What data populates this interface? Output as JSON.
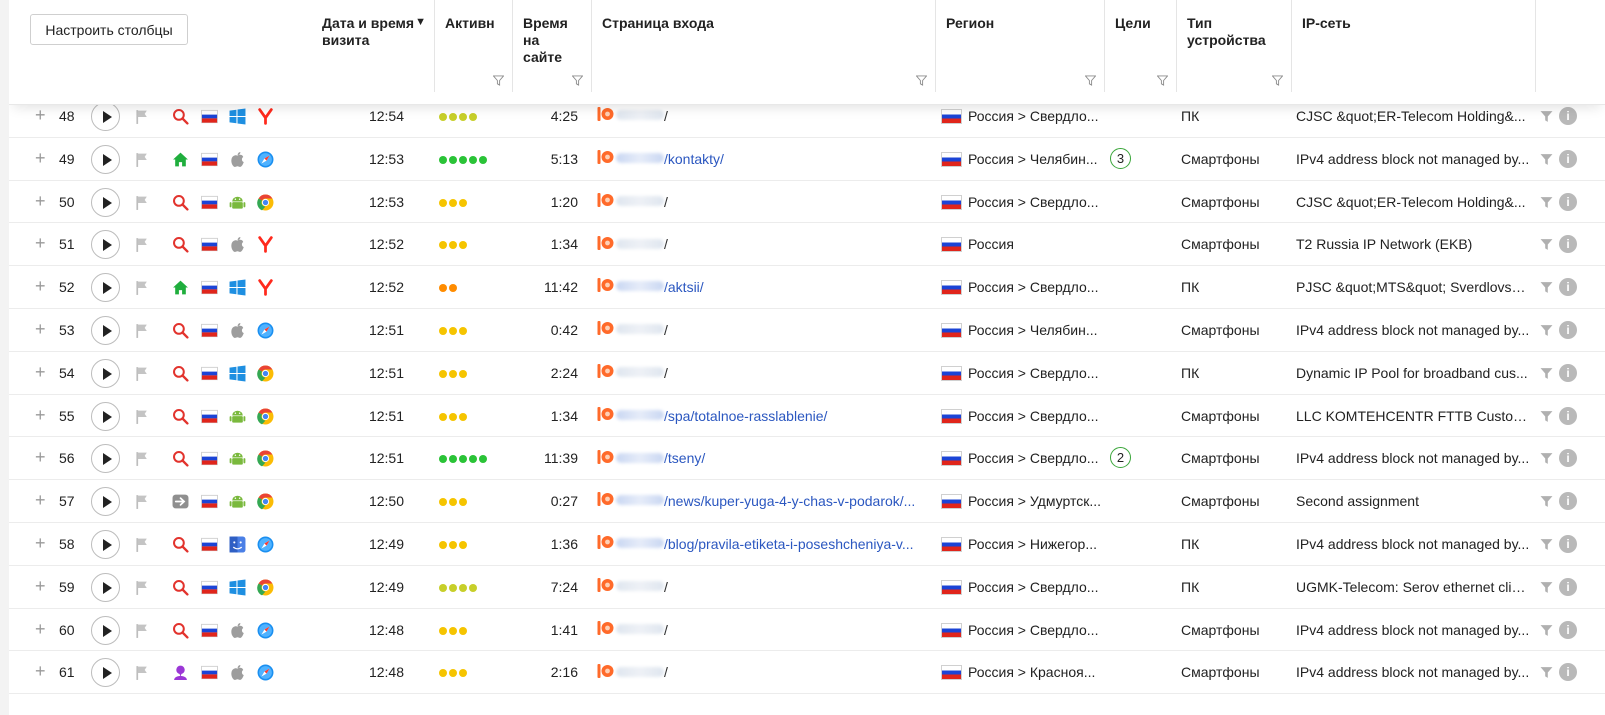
{
  "toolbar": {
    "configure_columns_label": "Настроить столбцы"
  },
  "columns": {
    "datetime": "Дата и время визита",
    "activity": "Активн",
    "duration": "Время на сайте",
    "entry_page": "Страница входа",
    "region": "Регион",
    "goals": "Цели",
    "device_type": "Тип устройства",
    "ip_network": "IP-сеть"
  },
  "colors": {
    "link": "#2b57c0",
    "goal_border": "#3aa63a",
    "dot_yellow": "#f5c400",
    "dot_lime": "#c7cf2a",
    "dot_green": "#2ac337",
    "dot_orange": "#ff8c00",
    "search_red": "#e2332d",
    "home_green": "#1fae3d"
  },
  "rows": [
    {
      "num": "48",
      "source": "search",
      "os": "windows",
      "browser": "yandex",
      "time": "12:54",
      "activity": 4,
      "activity_color": "lime",
      "duration": "4:25",
      "entry_path": "/",
      "region": "Россия > Свердло...",
      "goals": "",
      "device": "ПК",
      "ip_net": "CJSC &quot;ER-Telecom Holding&..."
    },
    {
      "num": "49",
      "source": "direct",
      "os": "apple",
      "browser": "safari",
      "time": "12:53",
      "activity": 5,
      "activity_color": "green",
      "duration": "5:13",
      "entry_path": "/kontakty/",
      "region": "Россия > Челябин...",
      "goals": "3",
      "device": "Смартфоны",
      "ip_net": "IPv4 address block not managed by..."
    },
    {
      "num": "50",
      "source": "search",
      "os": "android",
      "browser": "chrome",
      "time": "12:53",
      "activity": 3,
      "activity_color": "yellow",
      "duration": "1:20",
      "entry_path": "/",
      "region": "Россия > Свердло...",
      "goals": "",
      "device": "Смартфоны",
      "ip_net": "CJSC &quot;ER-Telecom Holding&..."
    },
    {
      "num": "51",
      "source": "search",
      "os": "apple",
      "browser": "yandex",
      "time": "12:52",
      "activity": 3,
      "activity_color": "yellow",
      "duration": "1:34",
      "entry_path": "/",
      "region": "Россия",
      "goals": "",
      "device": "Смартфоны",
      "ip_net": "T2 Russia IP Network (EKB)"
    },
    {
      "num": "52",
      "source": "direct",
      "os": "windows",
      "browser": "yandex",
      "time": "12:52",
      "activity": 2,
      "activity_color": "orange",
      "duration": "11:42",
      "entry_path": "/aktsii/",
      "region": "Россия > Свердло...",
      "goals": "",
      "device": "ПК",
      "ip_net": "PJSC &quot;MTS&quot; Sverdlovsk..."
    },
    {
      "num": "53",
      "source": "search",
      "os": "apple",
      "browser": "safari",
      "time": "12:51",
      "activity": 3,
      "activity_color": "yellow",
      "duration": "0:42",
      "entry_path": "/",
      "region": "Россия > Челябин...",
      "goals": "",
      "device": "Смартфоны",
      "ip_net": "IPv4 address block not managed by..."
    },
    {
      "num": "54",
      "source": "search",
      "os": "windows",
      "browser": "chrome",
      "time": "12:51",
      "activity": 3,
      "activity_color": "yellow",
      "duration": "2:24",
      "entry_path": "/",
      "region": "Россия > Свердло...",
      "goals": "",
      "device": "ПК",
      "ip_net": "Dynamic IP Pool for broadband cus..."
    },
    {
      "num": "55",
      "source": "search",
      "os": "android",
      "browser": "chrome",
      "time": "12:51",
      "activity": 3,
      "activity_color": "yellow",
      "duration": "1:34",
      "entry_path": "/spa/totalnoe-rasslablenie/",
      "region": "Россия > Свердло...",
      "goals": "",
      "device": "Смартфоны",
      "ip_net": "LLC KOMTEHCENTR FTTB Custom..."
    },
    {
      "num": "56",
      "source": "search",
      "os": "android",
      "browser": "chrome",
      "time": "12:51",
      "activity": 5,
      "activity_color": "green",
      "duration": "11:39",
      "entry_path": "/tseny/",
      "region": "Россия > Свердло...",
      "goals": "2",
      "device": "Смартфоны",
      "ip_net": "IPv4 address block not managed by..."
    },
    {
      "num": "57",
      "source": "referral",
      "os": "android",
      "browser": "chrome",
      "time": "12:50",
      "activity": 3,
      "activity_color": "yellow",
      "duration": "0:27",
      "entry_path": "/news/kuper-yuga-4-y-chas-v-podarok/...",
      "region": "Россия > Удмуртск...",
      "goals": "",
      "device": "Смартфоны",
      "ip_net": "Second assignment"
    },
    {
      "num": "58",
      "source": "search",
      "os": "macos",
      "browser": "safari",
      "time": "12:49",
      "activity": 3,
      "activity_color": "yellow",
      "duration": "1:36",
      "entry_path": "/blog/pravila-etiketa-i-poseshcheniya-v...",
      "region": "Россия > Нижегор...",
      "goals": "",
      "device": "ПК",
      "ip_net": "IPv4 address block not managed by..."
    },
    {
      "num": "59",
      "source": "search",
      "os": "windows",
      "browser": "chrome",
      "time": "12:49",
      "activity": 4,
      "activity_color": "lime",
      "duration": "7:24",
      "entry_path": "/",
      "region": "Россия > Свердло...",
      "goals": "",
      "device": "ПК",
      "ip_net": "UGMK-Telecom: Serov ethernet clie..."
    },
    {
      "num": "60",
      "source": "search",
      "os": "apple",
      "browser": "safari",
      "time": "12:48",
      "activity": 3,
      "activity_color": "yellow",
      "duration": "1:41",
      "entry_path": "/",
      "region": "Россия > Свердло...",
      "goals": "",
      "device": "Смартфоны",
      "ip_net": "IPv4 address block not managed by..."
    },
    {
      "num": "61",
      "source": "social",
      "os": "apple",
      "browser": "safari",
      "time": "12:48",
      "activity": 3,
      "activity_color": "yellow",
      "duration": "2:16",
      "entry_path": "/",
      "region": "Россия > Красноя...",
      "goals": "",
      "device": "Смартфоны",
      "ip_net": "IPv4 address block not managed by..."
    }
  ]
}
